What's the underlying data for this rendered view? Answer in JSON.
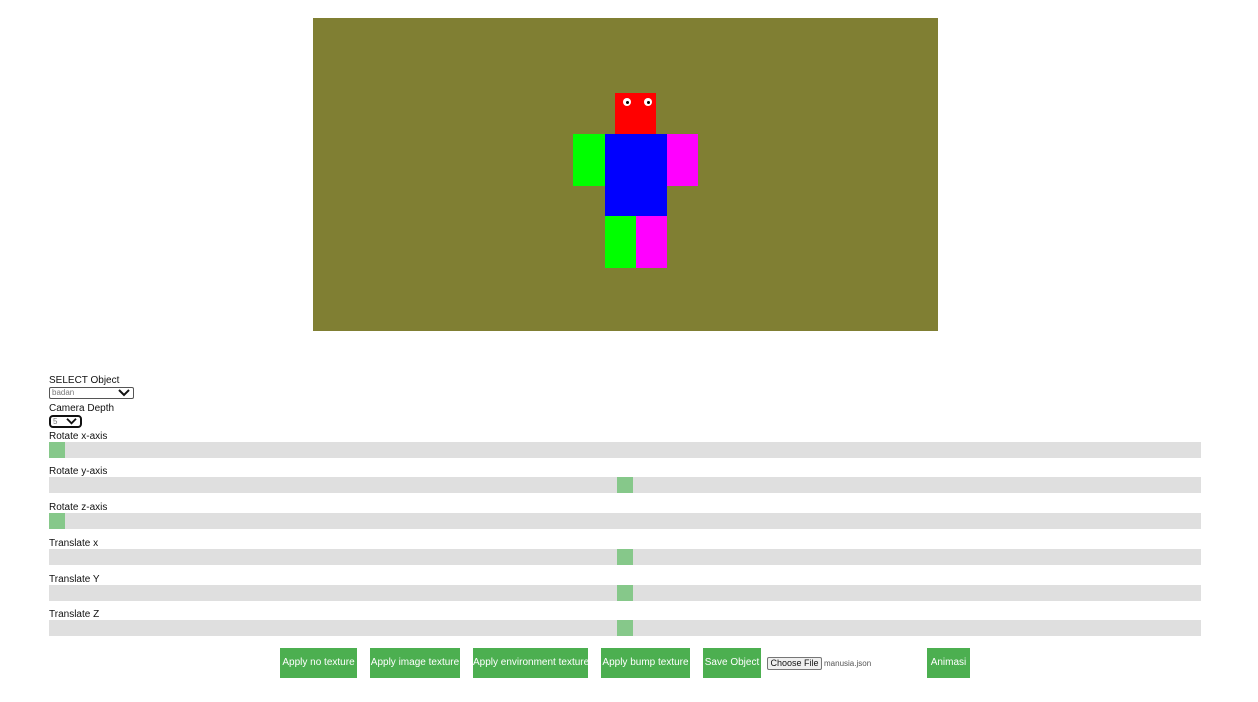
{
  "scene": {
    "background_color": "#807f33",
    "parts": {
      "head_color": "#ff0000",
      "body_color": "#0000ff",
      "left_arm_color": "#00ff00",
      "right_arm_color": "#ff00ff",
      "left_leg_color": "#00ff00",
      "right_leg_color": "#ff00ff",
      "eye_color": "#ffffff"
    }
  },
  "controls": {
    "select_object": {
      "label": "SELECT Object",
      "value": "badan"
    },
    "camera_depth": {
      "label": "Camera Depth",
      "value": "5"
    },
    "sliders": [
      {
        "label": "Rotate x-axis",
        "value_fraction": 0.0
      },
      {
        "label": "Rotate y-axis",
        "value_fraction": 0.5
      },
      {
        "label": "Rotate z-axis",
        "value_fraction": 0.0
      },
      {
        "label": "Translate x",
        "value_fraction": 0.5
      },
      {
        "label": "Translate Y",
        "value_fraction": 0.5
      },
      {
        "label": "Translate Z",
        "value_fraction": 0.5
      }
    ],
    "slider_track_color": "#dfdfdf",
    "slider_thumb_color": "#86c88a"
  },
  "toolbar": {
    "no_texture": "Apply no texture",
    "image_texture": "Apply image texture",
    "environment_texture": "Apply environment texture",
    "bump_texture": "Apply bump texture",
    "save_object": "Save Object",
    "choose_file": "Choose File",
    "file_name": "manusia.json",
    "animasi": "Animasi",
    "button_color": "#4caf50"
  }
}
